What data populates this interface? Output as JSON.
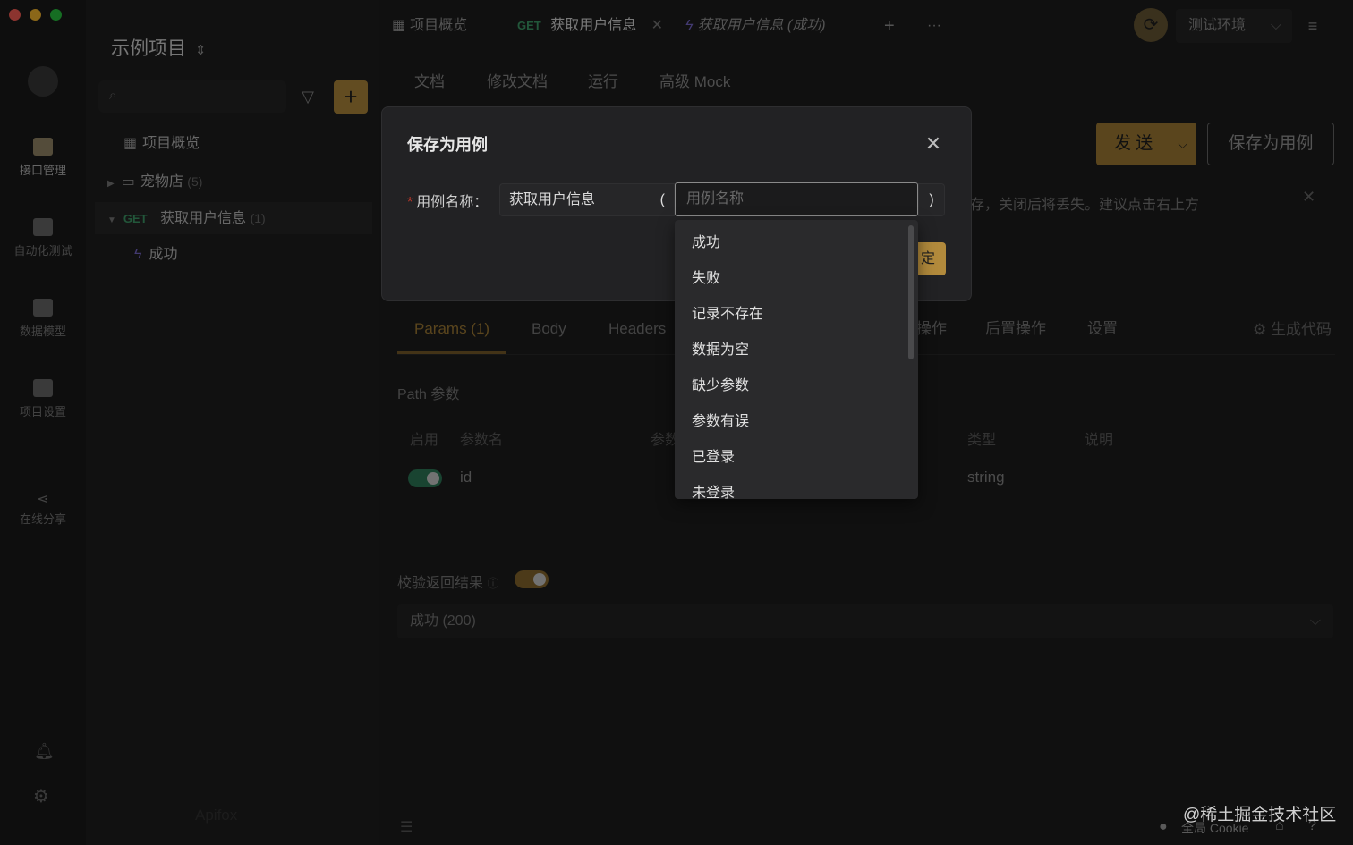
{
  "window": {
    "traffic_colors": [
      "#ff5f57",
      "#febc2e",
      "#28c840"
    ]
  },
  "rail": {
    "items": [
      {
        "label": "接口管理",
        "icon": "api-icon"
      },
      {
        "label": "自动化测试",
        "icon": "server-icon"
      },
      {
        "label": "数据模型",
        "icon": "model-icon"
      },
      {
        "label": "项目设置",
        "icon": "settings-file-icon"
      },
      {
        "label": "在线分享",
        "icon": "share-icon"
      }
    ]
  },
  "sidebar": {
    "project_title": "示例项目",
    "tree": [
      {
        "label": "项目概览"
      },
      {
        "label": "宠物店",
        "count": "(5)"
      },
      {
        "method": "GET",
        "label": "获取用户信息",
        "count": "(1)"
      },
      {
        "label": "成功"
      }
    ],
    "brand": "Apifox"
  },
  "top_tabs": [
    {
      "label": "项目概览"
    },
    {
      "method": "GET",
      "label": "获取用户信息"
    },
    {
      "label": "获取用户信息 (成功)"
    }
  ],
  "toolbar": {
    "env_label": "测试环境",
    "add_tab": "+",
    "more": "···"
  },
  "sub_tabs": [
    "文档",
    "修改文档",
    "运行",
    "高级 Mock"
  ],
  "actions": {
    "send_label": "发 送",
    "save_case_label": "保存为用例"
  },
  "notice": "存，关闭后将丢失。建议点击右上方",
  "req_tabs": [
    "Params (1)",
    "Body",
    "Headers",
    "操作",
    "后置操作",
    "设置"
  ],
  "gen_code": "生成代码",
  "params": {
    "section_label": "Path 参数",
    "headers": [
      "启用",
      "参数名",
      "参数",
      "类型",
      "说明"
    ],
    "row": {
      "name": "id",
      "type": "string",
      "enabled": true
    }
  },
  "verify": {
    "label": "校验返回结果",
    "response": "成功 (200)"
  },
  "modal": {
    "title": "保存为用例",
    "field_label": "用例名称：",
    "prefix": "获取用户信息",
    "open_paren": "(",
    "close_paren": ")",
    "placeholder": "用例名称",
    "confirm_label": "定",
    "options": [
      "成功",
      "失败",
      "记录不存在",
      "数据为空",
      "缺少参数",
      "参数有误",
      "已登录",
      "未登录"
    ]
  },
  "footer": {
    "cookie_label": "全局 Cookie",
    "watermark": "@稀土掘金技术社区"
  },
  "colors": {
    "accent": "#b28a3c",
    "get_method": "#3f9e6a",
    "toggle_on": "#2e7d5a"
  }
}
